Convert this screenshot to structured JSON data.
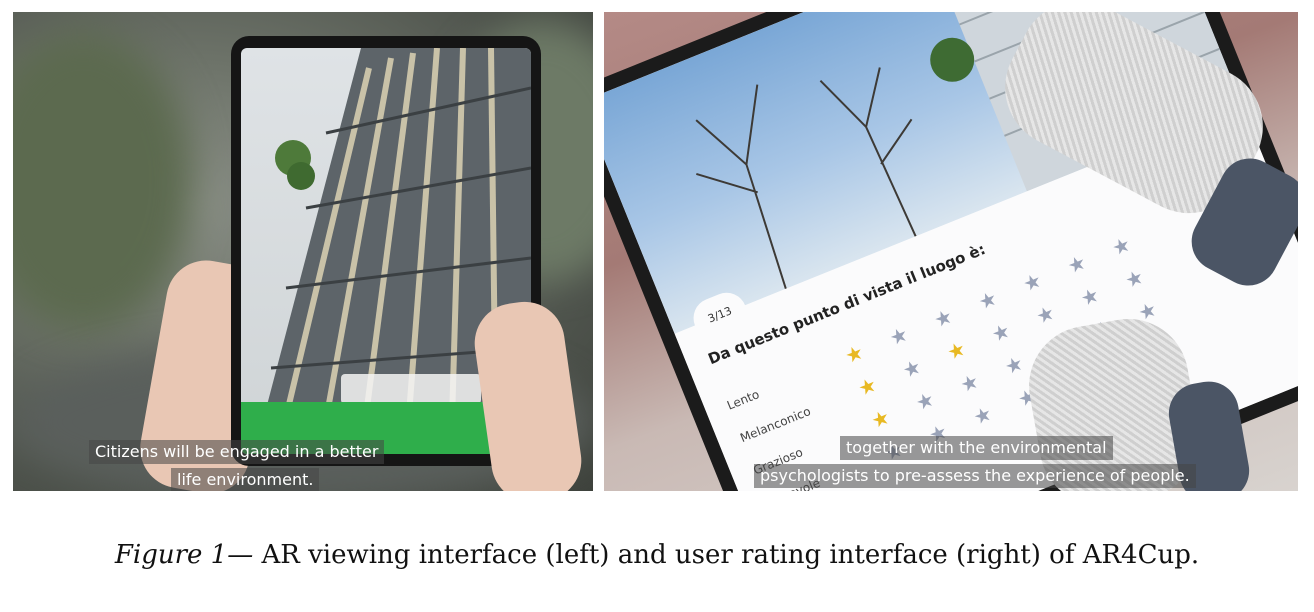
{
  "left_panel": {
    "subtitle_line1": "Citizens will be engaged in a better",
    "subtitle_line2": "life environment."
  },
  "right_panel": {
    "counter": "3/13",
    "question": "Da questo punto di vista il luogo è:",
    "adjectives": [
      "Lento",
      "Melanconico",
      "Grazioso",
      "Piacevole"
    ],
    "subtitle_line1": "together with the environmental",
    "subtitle_line2": "psychologists to pre-assess the experience of people."
  },
  "caption": {
    "lead": "Figure 1—",
    "text": " AR viewing interface (left) and user rating interface (right) of AR4Cup."
  },
  "colors": {
    "star_on": "#e8b923",
    "star_off": "#9aa3b8",
    "green_bar": "#2fae4b"
  }
}
